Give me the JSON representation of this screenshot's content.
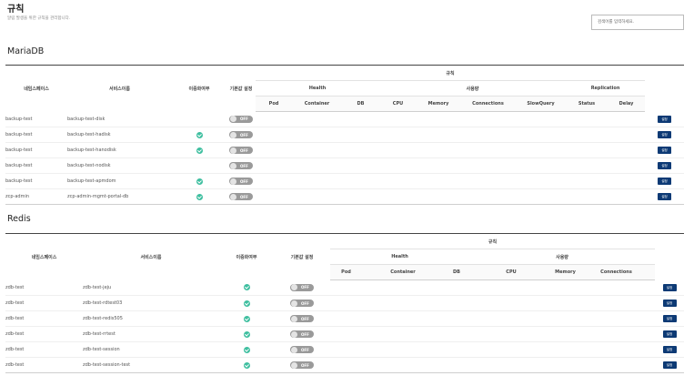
{
  "page": {
    "title": "규칙",
    "description": "알림 발생을 위한 규칙을 관리합니다.",
    "search_placeholder": "검색어를 입력하세요."
  },
  "colors": {
    "accent": "#0d3a75",
    "check": "#3fbfa0",
    "toggle_off": "#9a9a9a"
  },
  "icons": {
    "active": "check-circle-icon"
  },
  "mariadb": {
    "title": "MariaDB",
    "headers": {
      "namespace": "네임스페이스",
      "service": "서비스이름",
      "active": "이중화여부",
      "default": "기본값 설정",
      "rules": "규칙",
      "health": "Health",
      "usage": "사용량",
      "replication": "Replication",
      "pod": "Pod",
      "container": "Container",
      "db": "DB",
      "cpu": "CPU",
      "memory": "Memory",
      "connections": "Connections",
      "slowquery": "SlowQuery",
      "status": "Status",
      "delay": "Delay"
    },
    "rows": [
      {
        "namespace": "backup-test",
        "service": "backup-test-disk",
        "active": false,
        "toggle": "OFF",
        "button": "설정"
      },
      {
        "namespace": "backup-test",
        "service": "backup-test-hadisk",
        "active": true,
        "toggle": "OFF",
        "button": "설정"
      },
      {
        "namespace": "backup-test",
        "service": "backup-test-hanodisk",
        "active": true,
        "toggle": "OFF",
        "button": "설정"
      },
      {
        "namespace": "backup-test",
        "service": "backup-test-nodisk",
        "active": false,
        "toggle": "OFF",
        "button": "설정"
      },
      {
        "namespace": "backup-test",
        "service": "backup-test-apmdom",
        "active": true,
        "toggle": "OFF",
        "button": "설정"
      },
      {
        "namespace": "zcp-admin",
        "service": "zcp-admin-mgmt-portal-db",
        "active": true,
        "toggle": "OFF",
        "button": "설정"
      }
    ]
  },
  "redis": {
    "title": "Redis",
    "headers": {
      "namespace": "네임스페이스",
      "service": "서비스이름",
      "active": "이중화여부",
      "default": "기본값 설정",
      "rules": "규칙",
      "health": "Health",
      "usage": "사용량",
      "pod": "Pod",
      "container": "Container",
      "db": "DB",
      "cpu": "CPU",
      "memory": "Memory",
      "connections": "Connections"
    },
    "rows": [
      {
        "namespace": "zdb-test",
        "service": "zdb-test-jeju",
        "active": true,
        "toggle": "OFF",
        "button": "설정"
      },
      {
        "namespace": "zdb-test",
        "service": "zdb-test-rdtest03",
        "active": true,
        "toggle": "OFF",
        "button": "설정"
      },
      {
        "namespace": "zdb-test",
        "service": "zdb-test-redis505",
        "active": true,
        "toggle": "OFF",
        "button": "설정"
      },
      {
        "namespace": "zdb-test",
        "service": "zdb-test-rrtest",
        "active": true,
        "toggle": "OFF",
        "button": "설정"
      },
      {
        "namespace": "zdb-test",
        "service": "zdb-test-session",
        "active": true,
        "toggle": "OFF",
        "button": "설정"
      },
      {
        "namespace": "zdb-test",
        "service": "zdb-test-session-test",
        "active": true,
        "toggle": "OFF",
        "button": "설정"
      }
    ]
  }
}
